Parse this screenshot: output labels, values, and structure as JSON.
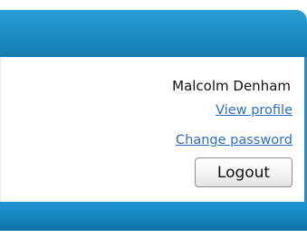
{
  "user": {
    "name": "Malcolm Denham"
  },
  "links": {
    "view_profile": "View profile",
    "change_password": "Change password"
  },
  "actions": {
    "logout_label": "Logout"
  },
  "colors": {
    "accent": "#1e8ec5",
    "link": "#2a6fc4"
  }
}
